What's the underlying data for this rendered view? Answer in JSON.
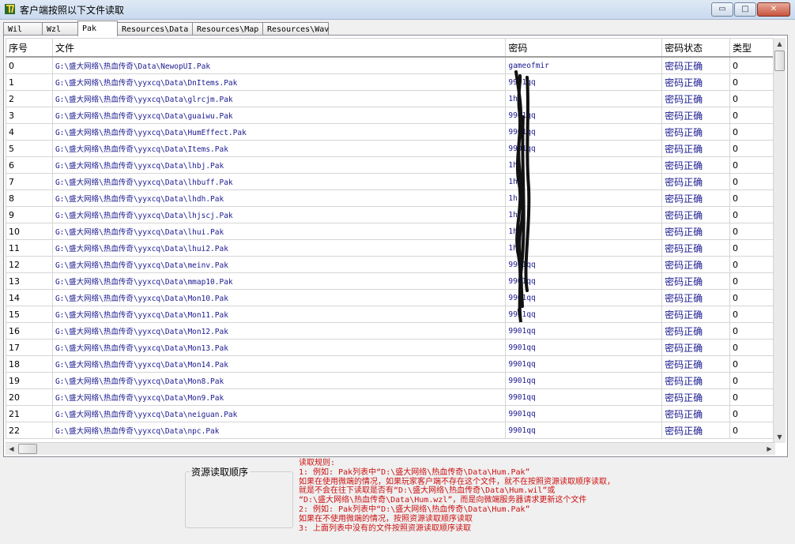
{
  "window": {
    "title": "客户端按照以下文件读取",
    "buttons": {
      "minimize": "▭",
      "maximize": "□",
      "close": "✕"
    }
  },
  "tabs": [
    {
      "label": "Wil",
      "active": false
    },
    {
      "label": "Wzl",
      "active": false
    },
    {
      "label": "Pak",
      "active": true
    },
    {
      "label": "Resources\\Data",
      "active": false
    },
    {
      "label": "Resources\\Map",
      "active": false
    },
    {
      "label": "Resources\\Wav",
      "active": false
    }
  ],
  "table": {
    "headers": [
      "序号",
      "文件",
      "密码",
      "密码状态",
      "类型"
    ],
    "rows": [
      {
        "idx": "0",
        "file": "G:\\盛大网络\\热血传奇\\Data\\NewopUI.Pak",
        "pwd": "gameofmir",
        "status": "密码正确",
        "type": "0"
      },
      {
        "idx": "1",
        "file": "G:\\盛大网络\\热血传奇\\yyxcq\\Data\\DnItems.Pak",
        "pwd": "9901qq",
        "status": "密码正确",
        "type": "0"
      },
      {
        "idx": "2",
        "file": "G:\\盛大网络\\热血传奇\\yyxcq\\Data\\glrcjm.Pak",
        "pwd": "1h",
        "status": "密码正确",
        "type": "0"
      },
      {
        "idx": "3",
        "file": "G:\\盛大网络\\热血传奇\\yyxcq\\Data\\guaiwu.Pak",
        "pwd": "9901qq",
        "status": "密码正确",
        "type": "0"
      },
      {
        "idx": "4",
        "file": "G:\\盛大网络\\热血传奇\\yyxcq\\Data\\HumEffect.Pak",
        "pwd": "9901qq",
        "status": "密码正确",
        "type": "0"
      },
      {
        "idx": "5",
        "file": "G:\\盛大网络\\热血传奇\\yyxcq\\Data\\Items.Pak",
        "pwd": "9901qq",
        "status": "密码正确",
        "type": "0"
      },
      {
        "idx": "6",
        "file": "G:\\盛大网络\\热血传奇\\yyxcq\\Data\\lhbj.Pak",
        "pwd": "1h",
        "status": "密码正确",
        "type": "0"
      },
      {
        "idx": "7",
        "file": "G:\\盛大网络\\热血传奇\\yyxcq\\Data\\lhbuff.Pak",
        "pwd": "1h",
        "status": "密码正确",
        "type": "0"
      },
      {
        "idx": "8",
        "file": "G:\\盛大网络\\热血传奇\\yyxcq\\Data\\lhdh.Pak",
        "pwd": "1h",
        "status": "密码正确",
        "type": "0"
      },
      {
        "idx": "9",
        "file": "G:\\盛大网络\\热血传奇\\yyxcq\\Data\\lhjscj.Pak",
        "pwd": "1h",
        "status": "密码正确",
        "type": "0"
      },
      {
        "idx": "10",
        "file": "G:\\盛大网络\\热血传奇\\yyxcq\\Data\\lhui.Pak",
        "pwd": "1h",
        "status": "密码正确",
        "type": "0"
      },
      {
        "idx": "11",
        "file": "G:\\盛大网络\\热血传奇\\yyxcq\\Data\\lhui2.Pak",
        "pwd": "1h",
        "status": "密码正确",
        "type": "0"
      },
      {
        "idx": "12",
        "file": "G:\\盛大网络\\热血传奇\\yyxcq\\Data\\meinv.Pak",
        "pwd": "9901qq",
        "status": "密码正确",
        "type": "0"
      },
      {
        "idx": "13",
        "file": "G:\\盛大网络\\热血传奇\\yyxcq\\Data\\mmap10.Pak",
        "pwd": "9901qq",
        "status": "密码正确",
        "type": "0"
      },
      {
        "idx": "14",
        "file": "G:\\盛大网络\\热血传奇\\yyxcq\\Data\\Mon10.Pak",
        "pwd": "9901qq",
        "status": "密码正确",
        "type": "0"
      },
      {
        "idx": "15",
        "file": "G:\\盛大网络\\热血传奇\\yyxcq\\Data\\Mon11.Pak",
        "pwd": "9901qq",
        "status": "密码正确",
        "type": "0"
      },
      {
        "idx": "16",
        "file": "G:\\盛大网络\\热血传奇\\yyxcq\\Data\\Mon12.Pak",
        "pwd": "9901qq",
        "status": "密码正确",
        "type": "0"
      },
      {
        "idx": "17",
        "file": "G:\\盛大网络\\热血传奇\\yyxcq\\Data\\Mon13.Pak",
        "pwd": "9901qq",
        "status": "密码正确",
        "type": "0"
      },
      {
        "idx": "18",
        "file": "G:\\盛大网络\\热血传奇\\yyxcq\\Data\\Mon14.Pak",
        "pwd": "9901qq",
        "status": "密码正确",
        "type": "0"
      },
      {
        "idx": "19",
        "file": "G:\\盛大网络\\热血传奇\\yyxcq\\Data\\Mon8.Pak",
        "pwd": "9901qq",
        "status": "密码正确",
        "type": "0"
      },
      {
        "idx": "20",
        "file": "G:\\盛大网络\\热血传奇\\yyxcq\\Data\\Mon9.Pak",
        "pwd": "9901qq",
        "status": "密码正确",
        "type": "0"
      },
      {
        "idx": "21",
        "file": "G:\\盛大网络\\热血传奇\\yyxcq\\Data\\neiguan.Pak",
        "pwd": "9901qq",
        "status": "密码正确",
        "type": "0"
      },
      {
        "idx": "22",
        "file": "G:\\盛大网络\\热血传奇\\yyxcq\\Data\\npc.Pak",
        "pwd": "9901qq",
        "status": "密码正确",
        "type": "0"
      }
    ]
  },
  "bottom": {
    "group_title": "资源读取顺序",
    "rules": [
      "读取规则:",
      "1: 例如: Pak列表中“D:\\盛大网络\\热血传奇\\Data\\Hum.Pak”",
      "   如果在使用微端的情况，如果玩家客户端不存在这个文件，就不在按照资源读取顺序读取，",
      "   就是不会在往下读取是否有“D:\\盛大网络\\热血传奇\\Data\\Hum.wil”或",
      "   “D:\\盛大网络\\热血传奇\\Data\\Hum.wzl”，而是向微端服务器请求更新这个文件",
      "2: 例如: Pak列表中“D:\\盛大网络\\热血传奇\\Data\\Hum.Pak”",
      "   如果在不使用微端的情况，按照资源读取顺序读取",
      "3: 上面列表中没有的文件按照资源读取顺序读取"
    ]
  },
  "colors": {
    "rules_text": "#cc1111",
    "cell_text": "#1a1a90"
  }
}
